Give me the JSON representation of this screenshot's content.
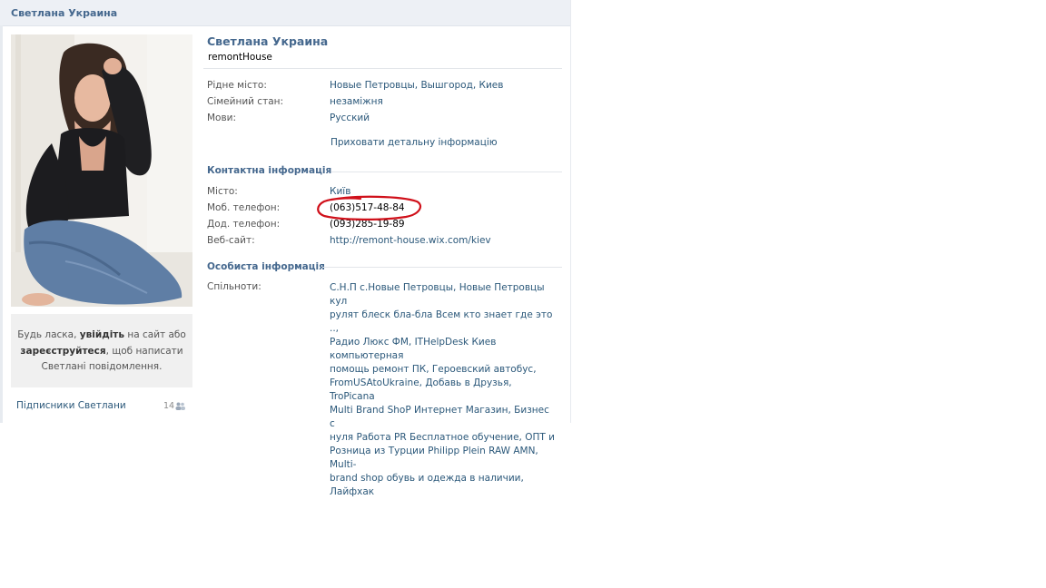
{
  "header": {
    "title": "Светлана Украина"
  },
  "profile": {
    "name": "Светлана Украина",
    "status": "remontHouse",
    "photo_icon": "user-photo"
  },
  "details": [
    {
      "label": "Рідне місто:",
      "value": "Новые Петровцы, Вышгород, Киев"
    },
    {
      "label": "Сімейний стан:",
      "value": "незаміжня"
    },
    {
      "label": "Мови:",
      "value": "Русский"
    }
  ],
  "hide_details_link": "Приховати детальну інформацію",
  "contact": {
    "title": "Контактна інформація",
    "rows": [
      {
        "label": "Місто:",
        "value": "Київ"
      },
      {
        "label": "Моб. телефон:",
        "value": "(063)517-48-84"
      },
      {
        "label": "Дод. телефон:",
        "value": "(093)285-19-89"
      },
      {
        "label": "Веб-сайт:",
        "value": "http://remont-house.wix.com/kiev"
      }
    ]
  },
  "personal": {
    "title": "Особиста інформація",
    "groups_label": "Спільноти:",
    "groups_lines": [
      "С.Н.П с.Новые Петровцы, Новые Петровцы кул",
      "рулят блеск бла-бла Всем кто знает где это ..,",
      "Радио Люкс ФМ, ITHelpDesk Киев компьютерная",
      "помощь ремонт ПК, Героевский автобус,",
      "FromUSAtoUkraine, Добавь в Друзья, TroPicana",
      "Multi Brand ShoP Интернет Магазин, Бизнес с",
      "нуля Работа PR Бесплатное обучение, ОПТ и",
      "Розница из Турции Philipp Plein RAW AMN, Multi-",
      "brand shop обувь и одежда в наличии, Лайфхак"
    ]
  },
  "login_prompt": {
    "line1_pre": "Будь ласка, ",
    "line1_bold": "увійдіть",
    "line1_post": " на сайт або",
    "line2_bold": "зареєструйтеся",
    "line2_post": ", щоб написати",
    "line3": "Светлані повідомлення."
  },
  "subscribers": {
    "label": "Підписники Светлани",
    "count": "14",
    "icon": "people-icon"
  },
  "annotation": {
    "color": "#d0101a"
  }
}
